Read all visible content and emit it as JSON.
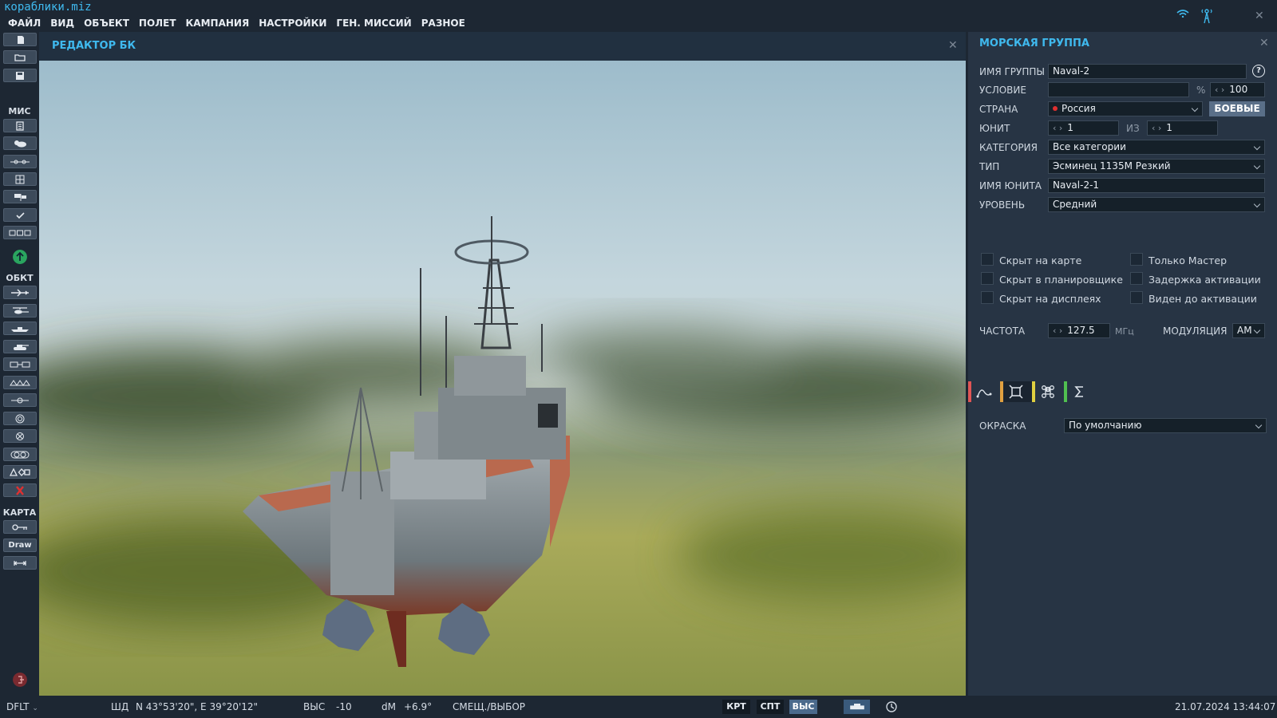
{
  "window": {
    "file_name": "кораблики.miz"
  },
  "menu": [
    "ФАЙЛ",
    "ВИД",
    "ОБЪЕКТ",
    "ПОЛЕТ",
    "КАМПАНИЯ",
    "НАСТРОЙКИ",
    "ГЕН. МИССИЙ",
    "РАЗНОЕ"
  ],
  "toolbar": {
    "section_mission": "МИС",
    "section_objects": "ОБКТ",
    "section_map": "КАРТА",
    "draw_label": "Draw"
  },
  "editor": {
    "title": "РЕДАКТОР БК"
  },
  "naval_group": {
    "title": "МОРСКАЯ ГРУППА",
    "group_name_label": "ИМЯ ГРУППЫ",
    "group_name_value": "Naval-2",
    "help_label": "?",
    "condition_label": "УСЛОВИЕ",
    "condition_value": "",
    "percent_symbol": "%",
    "probability_value": "100",
    "country_label": "СТРАНА",
    "country_value": "Россия",
    "country_color": "#e03030",
    "combat_button": "БОЕВЫЕ",
    "unit_label": "ЮНИТ",
    "unit_value": "1",
    "of_label": "ИЗ",
    "unit_total": "1",
    "category_label": "КАТЕГОРИЯ",
    "category_value": "Все категории",
    "type_label": "ТИП",
    "type_value": "Эсминец 1135М Резкий",
    "unit_name_label": "ИМЯ ЮНИТА",
    "unit_name_value": "Naval-2-1",
    "level_label": "УРОВЕНЬ",
    "level_value": "Средний",
    "checkboxes": {
      "hidden_map": "Скрыт на карте",
      "hidden_planner": "Скрыт в планировщике",
      "hidden_displays": "Скрыт на дисплеях",
      "master_only": "Только Мастер",
      "late_activation": "Задержка активации",
      "visible_before_activation": "Виден до активации"
    },
    "frequency_label": "ЧАСТОТА",
    "frequency_value": "127.5",
    "frequency_unit": "МГц",
    "modulation_label": "МОДУЛЯЦИЯ",
    "modulation_value": "AM",
    "livery_label": "ОКРАСКА",
    "livery_value": "По умолчанию",
    "tab_colors": [
      "#e05555",
      "#e0a040",
      "#e0d040",
      "#50c050"
    ]
  },
  "status": {
    "profile": "DFLT",
    "coord_label": "ШД",
    "coord_value": "N 43°53'20\", E 39°20'12\"",
    "alt_label": "ВЫС",
    "alt_value": "-10",
    "dm_label": "dM",
    "dm_value": "+6.9°",
    "mode": "СМЕЩ./ВЫБОР",
    "btn_map": "КРТ",
    "btn_sat": "СПТ",
    "btn_alt": "ВЫС",
    "datetime": "21.07.2024 13:44:07"
  }
}
